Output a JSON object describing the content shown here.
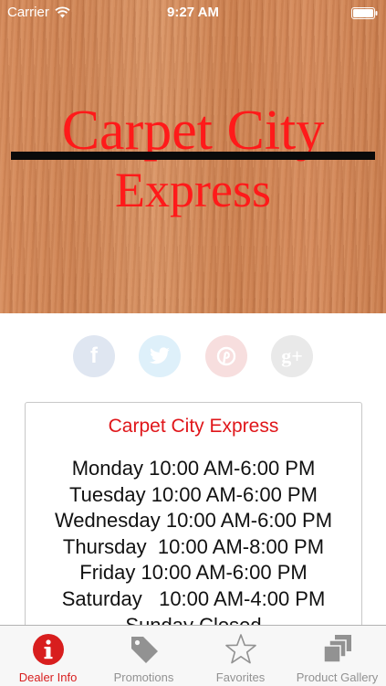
{
  "status_bar": {
    "carrier": "Carrier",
    "time": "9:27 AM"
  },
  "banner": {
    "line1": "Carpet City",
    "line2": "Express"
  },
  "social": [
    {
      "name": "facebook",
      "glyph": "f"
    },
    {
      "name": "twitter",
      "glyph": "t"
    },
    {
      "name": "pinterest",
      "glyph": "p"
    },
    {
      "name": "google-plus",
      "glyph": "g+"
    }
  ],
  "dealer": {
    "name": "Carpet City Express",
    "hours": [
      "Monday 10:00 AM-6:00 PM",
      "Tuesday 10:00 AM-6:00 PM",
      "Wednesday 10:00 AM-6:00 PM",
      "Thursday  10:00 AM-8:00 PM",
      "Friday 10:00 AM-6:00 PM",
      "Saturday   10:00 AM-4:00 PM",
      "Sunday Closed"
    ]
  },
  "tabs": [
    {
      "label": "Dealer Info",
      "icon": "info-icon",
      "active": true
    },
    {
      "label": "Promotions",
      "icon": "tag-icon",
      "active": false
    },
    {
      "label": "Favorites",
      "icon": "star-icon",
      "active": false
    },
    {
      "label": "Product Gallery",
      "icon": "gallery-icon",
      "active": false
    }
  ],
  "colors": {
    "accent": "#d81e1e",
    "banner_text": "#ff1a1a",
    "tab_inactive": "#929292"
  }
}
